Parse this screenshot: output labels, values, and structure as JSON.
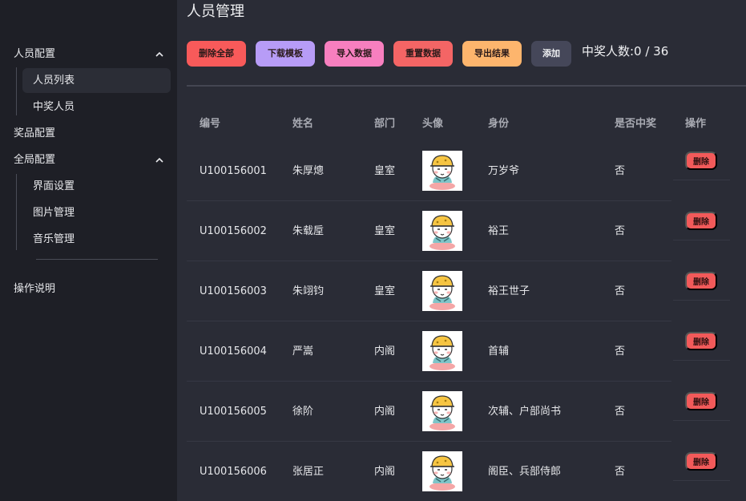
{
  "sidebar": {
    "groups": [
      {
        "label": "人员配置",
        "items": [
          "人员列表",
          "中奖人员"
        ]
      },
      {
        "label": "奖品配置"
      },
      {
        "label": "全局配置",
        "items": [
          "界面设置",
          "图片管理",
          "音乐管理"
        ]
      },
      {
        "label": "操作说明"
      }
    ],
    "active_item": "人员列表"
  },
  "main": {
    "title": "人员管理",
    "toolbar": {
      "delete_all": "删除全部",
      "download_template": "下载模板",
      "import_data": "导入数据",
      "reset_data": "重置数据",
      "export_results": "导出结果",
      "add": "添加"
    },
    "counter_text": "中奖人数:0 / 36",
    "colors": {
      "delete_all": "#f85a5a",
      "download_template": "#b79cf7",
      "import_data": "#f77fbf",
      "reset_data": "#f46565",
      "export_results": "#fdb56d",
      "add": "#454759",
      "delete_row": "#f25a5a"
    },
    "table": {
      "headers": [
        "编号",
        "姓名",
        "部门",
        "头像",
        "身份",
        "是否中奖",
        "操作"
      ],
      "rows": [
        {
          "id": "U100156001",
          "name": "朱厚熜",
          "dept": "皇室",
          "identity": "万岁爷",
          "won": "否",
          "action": "删除"
        },
        {
          "id": "U100156002",
          "name": "朱载垕",
          "dept": "皇室",
          "identity": "裕王",
          "won": "否",
          "action": "删除"
        },
        {
          "id": "U100156003",
          "name": "朱翊钧",
          "dept": "皇室",
          "identity": "裕王世子",
          "won": "否",
          "action": "删除"
        },
        {
          "id": "U100156004",
          "name": "严嵩",
          "dept": "内阁",
          "identity": "首辅",
          "won": "否",
          "action": "删除"
        },
        {
          "id": "U100156005",
          "name": "徐阶",
          "dept": "内阁",
          "identity": "次辅、户部尚书",
          "won": "否",
          "action": "删除"
        },
        {
          "id": "U100156006",
          "name": "张居正",
          "dept": "内阁",
          "identity": "阁臣、兵部侍郎",
          "won": "否",
          "action": "删除"
        }
      ]
    }
  }
}
